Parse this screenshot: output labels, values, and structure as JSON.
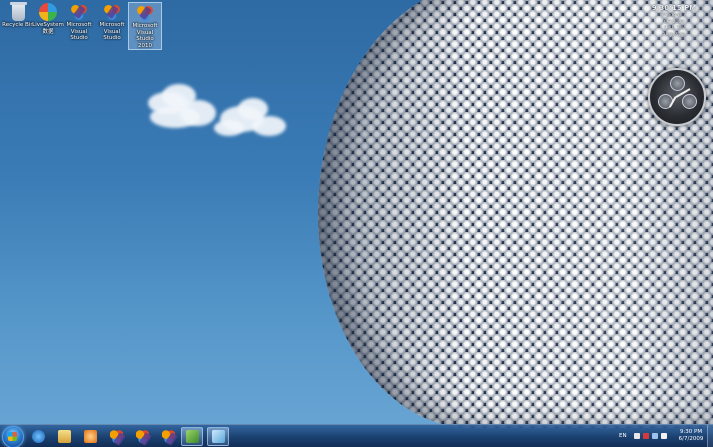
{
  "desktop": {
    "icons": [
      {
        "label": "Recycle Bin",
        "icon": "recycle-bin-icon",
        "selected": false
      },
      {
        "label": "LiveSystem 数据",
        "icon": "live-system-icon",
        "selected": false
      },
      {
        "label": "Microsoft Visual Studio",
        "icon": "visual-studio-icon",
        "selected": false
      },
      {
        "label": "Microsoft Visual Studio",
        "icon": "visual-studio-icon",
        "selected": false
      },
      {
        "label": "Microsoft Visual Studio 2010",
        "icon": "visual-studio-icon",
        "selected": true
      }
    ]
  },
  "gadgets": {
    "clock_panel": {
      "time": "9:30:15 PM",
      "lines": [
        "Windows 7",
        "6/7/2009",
        "CPU: 3%",
        "RAM: 52%"
      ]
    },
    "analog_clock": {
      "icon": "analog-clock-icon"
    }
  },
  "taskbar": {
    "start_icon": "start-orb-icon",
    "pinned": [
      {
        "name": "internet-explorer",
        "icon": "internet-explorer-icon",
        "color": "#2a7fd4",
        "active": false
      },
      {
        "name": "windows-explorer",
        "icon": "folder-icon",
        "color": "#e8c15a",
        "active": false
      },
      {
        "name": "media-player",
        "icon": "media-player-icon",
        "color": "#f08a1c",
        "active": false
      },
      {
        "name": "visual-studio-1",
        "icon": "visual-studio-icon",
        "color": "#d8643a",
        "active": false
      },
      {
        "name": "visual-studio-2",
        "icon": "visual-studio-icon",
        "color": "#d8643a",
        "active": false
      },
      {
        "name": "visual-studio-3",
        "icon": "visual-studio-icon",
        "color": "#d8643a",
        "active": false
      },
      {
        "name": "network-app",
        "icon": "network-icon",
        "color": "#6fb24a",
        "active": true
      },
      {
        "name": "paint",
        "icon": "paint-icon",
        "color": "#7ec0e8",
        "active": true
      }
    ],
    "tray": {
      "language": "EN",
      "time": "9:30 PM",
      "date": "6/7/2009"
    }
  }
}
